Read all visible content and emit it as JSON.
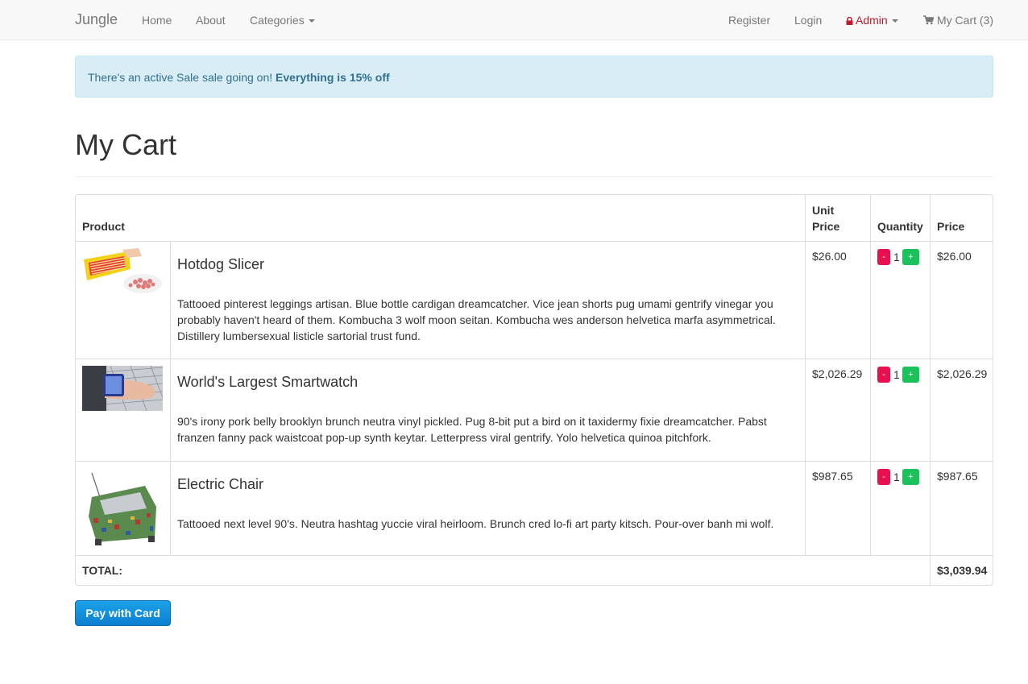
{
  "nav": {
    "brand": "Jungle",
    "home": "Home",
    "about": "About",
    "categories": "Categories",
    "register": "Register",
    "login": "Login",
    "admin": "Admin",
    "cart": "My Cart (3)"
  },
  "alert": {
    "text": "There's an active Sale sale going on! ",
    "highlight": "Everything is 15% off"
  },
  "page_title": "My Cart",
  "table": {
    "headers": {
      "product": "Product",
      "unit_price": "Unit Price",
      "quantity": "Quantity",
      "price": "Price"
    },
    "rows": [
      {
        "name": "Hotdog Slicer",
        "description": "Tattooed pinterest leggings artisan. Blue bottle cardigan dreamcatcher. Vice jean shorts pug umami gentrify vinegar you probably haven't heard of them. Kombucha 3 wolf moon seitan. Kombucha wes anderson helvetica marfa asymmetrical. Distillery lumbersexual listicle sartorial trust fund.",
        "unit_price": "$26.00",
        "quantity": "1",
        "price": "$26.00"
      },
      {
        "name": "World's Largest Smartwatch",
        "description": "90's irony pork belly brooklyn brunch neutra vinyl pickled. Pug 8-bit put a bird on it taxidermy fixie dreamcatcher. Pabst franzen fanny pack waistcoat pop-up synth keytar. Letterpress viral gentrify. Yolo helvetica quinoa pitchfork.",
        "unit_price": "$2,026.29",
        "quantity": "1",
        "price": "$2,026.29"
      },
      {
        "name": "Electric Chair",
        "description": "Tattooed next level 90's. Neutra hashtag yuccie viral heirloom. Brunch cred lo-fi art party kitsch. Pour-over banh mi wolf.",
        "unit_price": "$987.65",
        "quantity": "1",
        "price": "$987.65"
      }
    ],
    "minus_label": "-",
    "plus_label": "+",
    "total_label": "TOTAL:",
    "total_value": "$3,039.94"
  },
  "pay_button": "Pay with Card",
  "colors": {
    "navbar_bg": "#f8f8f8",
    "admin": "#b81c2e",
    "alert_bg": "#d9edf7",
    "alert_text": "#31708f",
    "minus_btn": "#e8104f",
    "plus_btn": "#1bc15a",
    "pay_btn": "#1589d8"
  },
  "icons": {
    "admin": "lock-icon",
    "cart": "shopping-cart-icon",
    "dropdown": "caret-down-icon"
  }
}
